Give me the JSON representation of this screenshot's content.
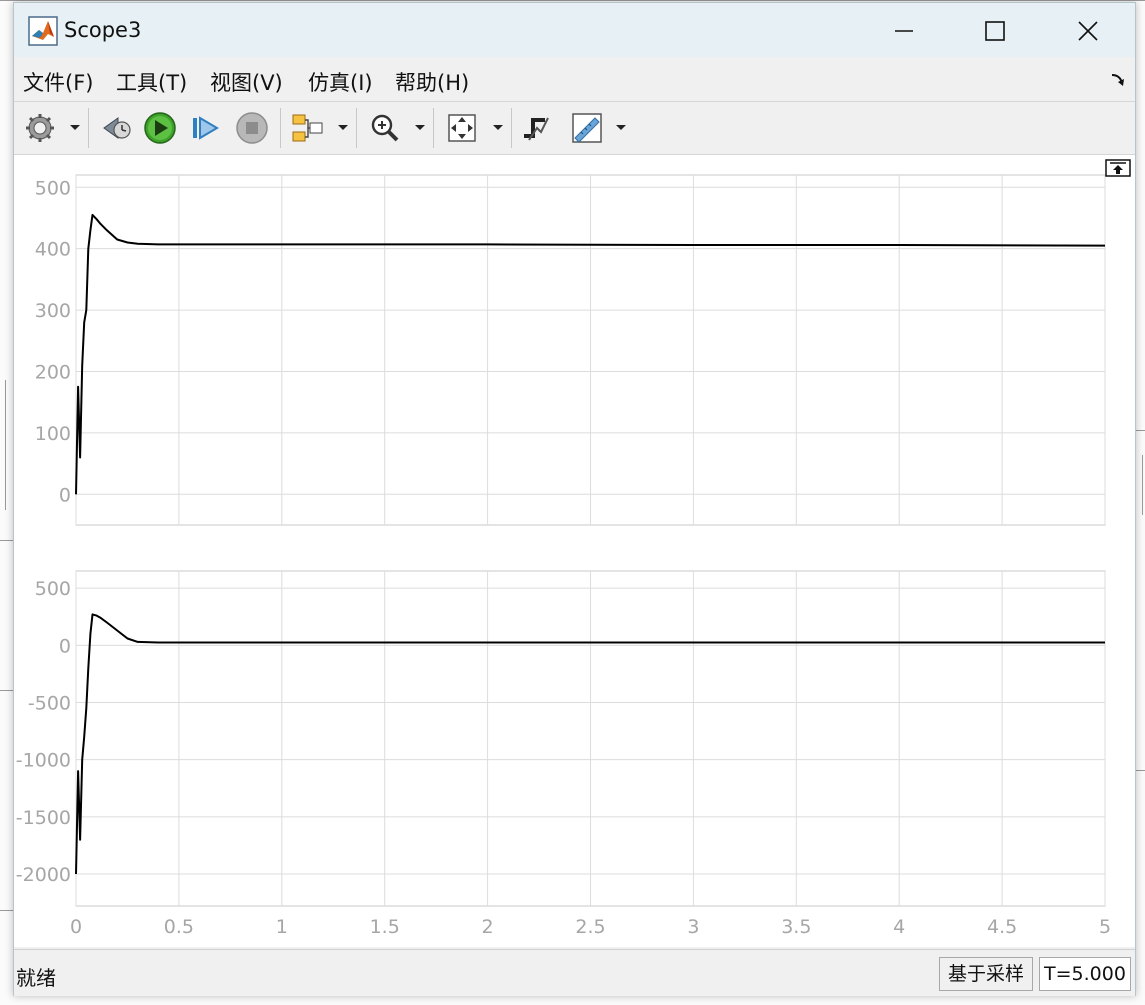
{
  "window": {
    "title": "Scope3"
  },
  "menu": [
    {
      "label": "文件(F)"
    },
    {
      "label": "工具(T)"
    },
    {
      "label": "视图(V)"
    },
    {
      "label": "仿真(I)"
    },
    {
      "label": "帮助(H)"
    }
  ],
  "toolbar": [
    "settings-icon",
    "step-back-icon",
    "run-icon",
    "step-forward-icon",
    "stop-icon",
    "signal-selector-icon",
    "zoom-in-icon",
    "fit-view-icon",
    "trigger-icon",
    "measurements-icon"
  ],
  "status": {
    "text": "就绪",
    "mode": "基于采样",
    "time": "T=5.000"
  },
  "colors": {
    "title_bg": "#e7f1f5",
    "toolbar_bg": "#f0f0f0",
    "grid": "#dcdcdc",
    "axis_text": "#a6a6a6",
    "trace": "#000000",
    "run_green": "#3fa02a"
  },
  "chart_data": [
    {
      "type": "line",
      "x_ticks": [
        "0",
        "0.5",
        "1",
        "1.5",
        "2",
        "2.5",
        "3",
        "3.5",
        "4",
        "4.5",
        "5"
      ],
      "y_ticks": [
        "0",
        "100",
        "200",
        "300",
        "400",
        "500"
      ],
      "xlim": [
        0,
        5
      ],
      "ylim": [
        -50,
        520
      ],
      "grid": true,
      "series": [
        {
          "x": [
            0,
            0.01,
            0.02,
            0.03,
            0.04,
            0.05,
            0.06,
            0.07,
            0.08,
            0.1,
            0.12,
            0.15,
            0.2,
            0.25,
            0.3,
            0.4,
            0.6,
            1.0,
            2.0,
            3.0,
            4.0,
            5.0
          ],
          "values": [
            0,
            175,
            60,
            210,
            280,
            300,
            400,
            430,
            455,
            448,
            440,
            430,
            415,
            410,
            408,
            407,
            407,
            407,
            407,
            406,
            406,
            405
          ]
        }
      ]
    },
    {
      "type": "line",
      "x_ticks": [
        "0",
        "0.5",
        "1",
        "1.5",
        "2",
        "2.5",
        "3",
        "3.5",
        "4",
        "4.5",
        "5"
      ],
      "y_ticks": [
        "500",
        "0",
        "-500",
        "-1000",
        "-1500",
        "-2000"
      ],
      "xlim": [
        0,
        5
      ],
      "ylim": [
        -2280,
        650
      ],
      "grid": true,
      "series": [
        {
          "x": [
            0,
            0.01,
            0.02,
            0.03,
            0.04,
            0.05,
            0.06,
            0.07,
            0.08,
            0.1,
            0.12,
            0.15,
            0.2,
            0.25,
            0.3,
            0.4,
            0.6,
            1.0,
            2.0,
            3.0,
            4.0,
            5.0
          ],
          "values": [
            -2000,
            -1100,
            -1700,
            -1000,
            -800,
            -550,
            -200,
            100,
            270,
            260,
            240,
            200,
            130,
            60,
            30,
            25,
            25,
            25,
            25,
            25,
            25,
            25
          ]
        }
      ]
    }
  ]
}
